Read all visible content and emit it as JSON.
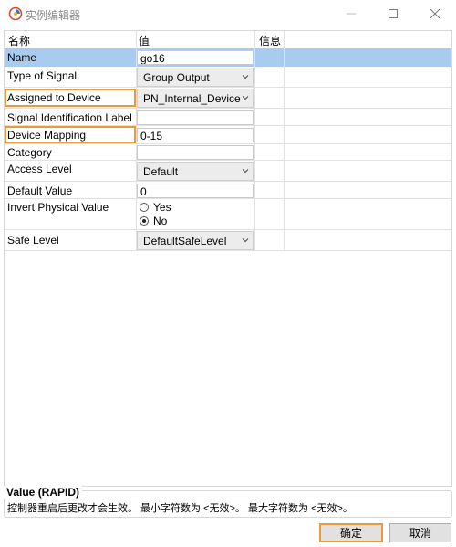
{
  "window": {
    "title": "实例编辑器",
    "colors": {
      "accent_highlight": "#e89a3c",
      "selection": "#a9cbef"
    }
  },
  "grid": {
    "headers": {
      "name": "名称",
      "value": "值",
      "info": "信息"
    },
    "rows": [
      {
        "label": "Name",
        "value": "go16"
      },
      {
        "label": "Type of Signal",
        "value": "Group Output"
      },
      {
        "label": "Assigned to Device",
        "value": "PN_Internal_Device"
      },
      {
        "label": "Signal Identification Label",
        "value": ""
      },
      {
        "label": "Device Mapping",
        "value": "0-15"
      },
      {
        "label": "Category",
        "value": ""
      },
      {
        "label": "Access Level",
        "value": "Default"
      },
      {
        "label": "Default Value",
        "value": "0"
      },
      {
        "label": "Invert Physical Value",
        "options": [
          "Yes",
          "No"
        ],
        "selected": "No"
      },
      {
        "label": "Safe Level",
        "value": "DefaultSafeLevel"
      }
    ]
  },
  "description": {
    "title": "Value (RAPID)",
    "text": "控制器重启后更改才会生效。 最小字符数为 <无效>。 最大字符数为 <无效>。"
  },
  "buttons": {
    "ok": "确定",
    "cancel": "取消"
  }
}
